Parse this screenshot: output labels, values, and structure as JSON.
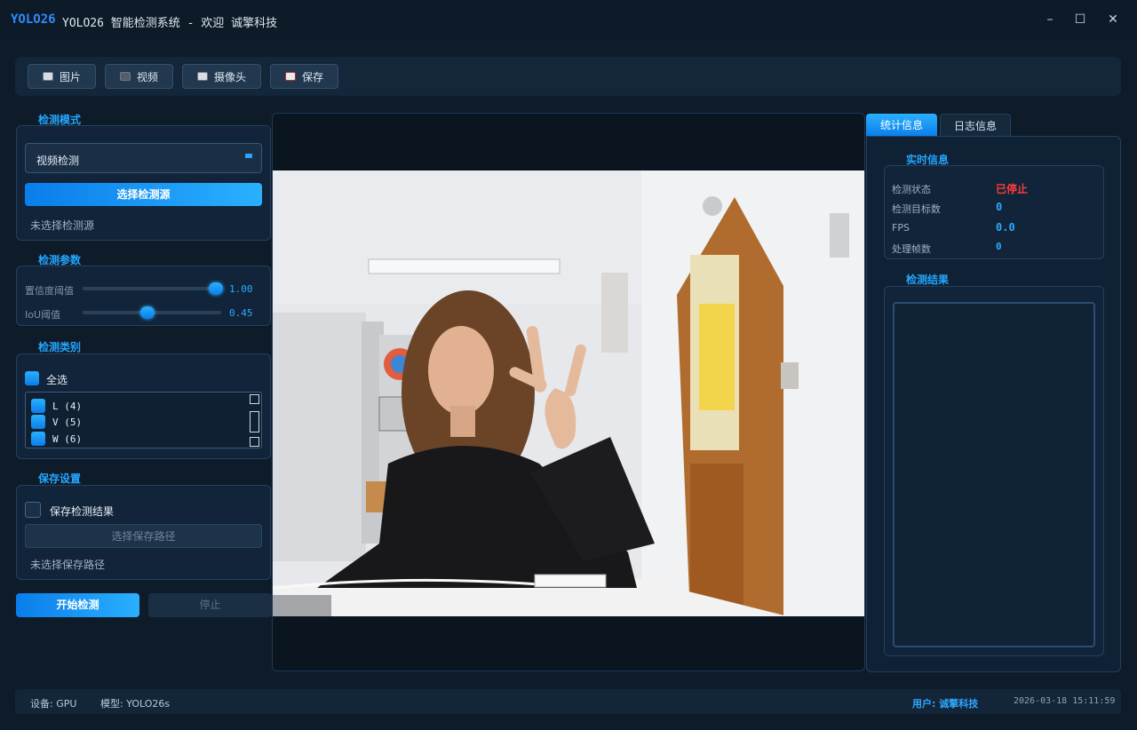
{
  "app": {
    "logo": "YOLO26",
    "window_title": "YOLO26 智能检测系统 - 欢迎 诚擎科技"
  },
  "window_controls": {
    "minimize": "–",
    "maximize": "☐",
    "close": "✕"
  },
  "toolbar": {
    "image": "图片",
    "video": "视频",
    "camera": "摄像头",
    "save": "保存"
  },
  "left": {
    "mode_section": "检测模式",
    "mode_value": "视频检测",
    "select_source": "选择检测源",
    "source_status": "未选择检测源",
    "params_section": "检测参数",
    "conf_label": "置信度阈值",
    "conf_value": "1.00",
    "conf_fraction": 1.0,
    "iou_label": "IoU阈值",
    "iou_value": "0.45",
    "iou_fraction": 0.45,
    "class_section": "检测类别",
    "select_all": "全选",
    "classes": [
      "L (4)",
      "V (5)",
      "W (6)"
    ],
    "save_section": "保存设置",
    "save_results": "保存检测结果",
    "choose_path": "选择保存路径",
    "path_status": "未选择保存路径",
    "start": "开始检测",
    "stop": "停止"
  },
  "right": {
    "tab_stats": "统计信息",
    "tab_logs": "日志信息",
    "realtime_title": "实时信息",
    "status_label": "检测状态",
    "status_value": "已停止",
    "count_label": "检测目标数",
    "count_value": "0",
    "fps_label": "FPS",
    "fps_value": "0.0",
    "frames_label": "处理帧数",
    "frames_value": "0",
    "results_title": "检测结果"
  },
  "status": {
    "device": "设备: GPU",
    "model": "模型: YOLO26s",
    "user": "用户: 诚擎科技",
    "time": "2026-03-18 15:11:59"
  },
  "colors": {
    "accent": "#1a9cff",
    "stopped": "#ff3b3b",
    "background": "#0e1b29"
  }
}
